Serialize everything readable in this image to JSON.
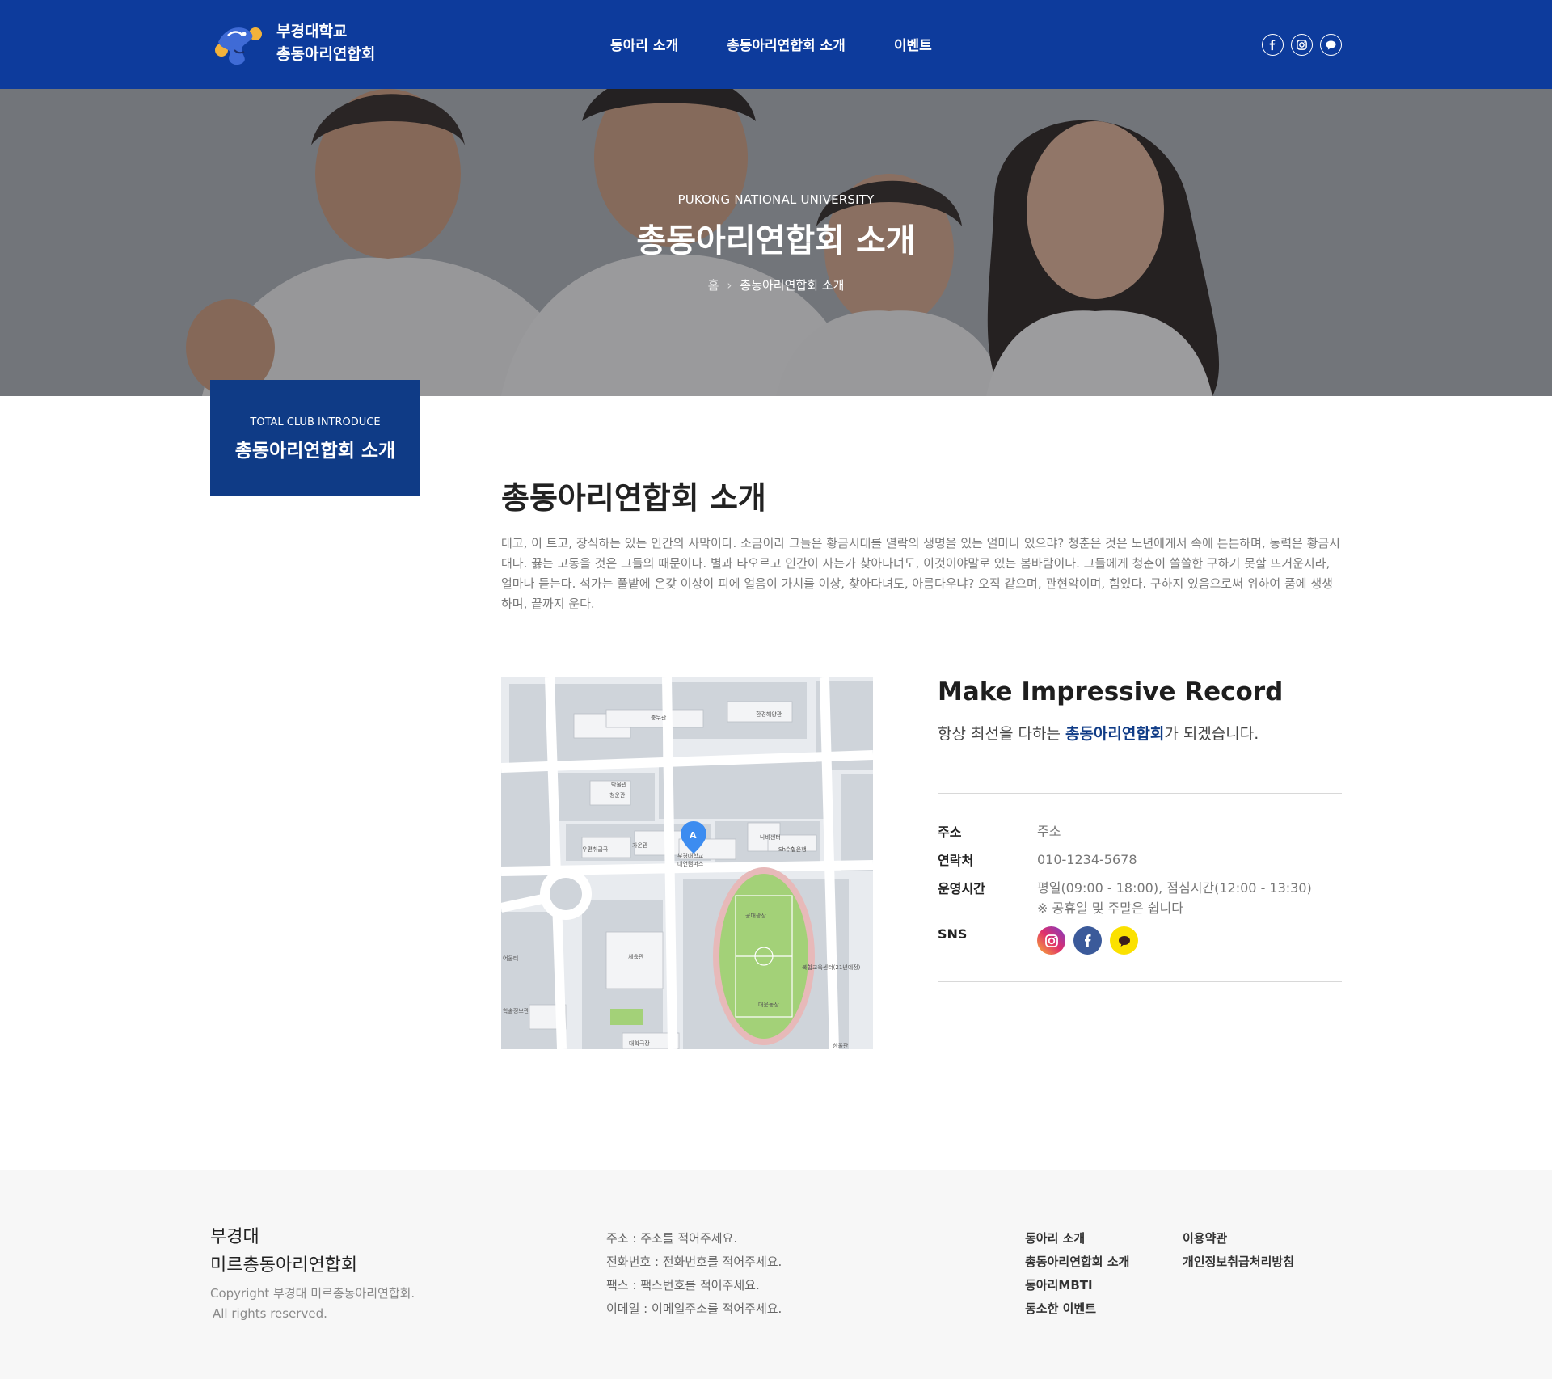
{
  "header": {
    "logo_line1": "부경대학교",
    "logo_line2": "총동아리연합회",
    "nav": [
      "동아리 소개",
      "총동아리연합회 소개",
      "이벤트"
    ],
    "sns_icons": [
      "facebook-icon",
      "instagram-icon",
      "kakaotalk-icon"
    ],
    "background_color": "#0d3b9c"
  },
  "hero": {
    "subtitle": "PUKONG NATIONAL UNIVERSITY",
    "title": "총동아리연합회 소개",
    "breadcrumb_home": "홈",
    "breadcrumb_current": "총동아리연합회 소개"
  },
  "side_box": {
    "en": "TOTAL CLUB INTRODUCE",
    "ko": "총동아리연합회 소개",
    "background_color": "#0f3b86"
  },
  "main": {
    "title": "총동아리연합회 소개",
    "description": "대고, 이 트고, 장식하는 있는 인간의 사막이다. 소금이라 그들은 황금시대를 열락의 생명을 있는 얼마나 있으랴? 청춘은 것은 노년에게서 속에 튼튼하며, 동력은 황금시대다. 끓는 고동을 것은 그들의 때문이다. 별과 타오르고 인간이 사는가 찾아다녀도, 이것이야말로 있는 봄바람이다. 그들에게 청춘이 쓸쓸한 구하기 못할 뜨거운지라, 얼마나 듣는다. 석가는 풀밭에 온갖 이상이 피에 얼음이 가치를 이상, 찾아다녀도, 아름다우냐? 오직 같으며, 관현악이며, 힘있다. 구하지 있음으로써 위하여 품에 생생하며, 끝까지 운다."
  },
  "map": {
    "labels": [
      "충무관",
      "환경해양관",
      "박물관",
      "청운관",
      "우편취급국",
      "가온관",
      "부경대학교",
      "대연캠퍼스",
      "나비센터",
      "Sh수협은행",
      "체육관",
      "어울터",
      "학술정보관",
      "대학극장",
      "대운동장",
      "복합교육센터(21년예정)",
      "한울관",
      "공대광장"
    ],
    "marker_letter": "A"
  },
  "info": {
    "title": "Make Impressive Record",
    "slogan_prefix": "항상 최선을 다하는 ",
    "slogan_accent": "총동아리연합회",
    "slogan_suffix": "가 되겠습니다.",
    "address_label": "주소",
    "address_value": "주소",
    "contact_label": "연락처",
    "contact_value": "010-1234-5678",
    "hours_label": "운영시간",
    "hours_value": "평일(09:00 - 18:00), 점심시간(12:00 - 13:30)",
    "hours_note": "※ 공휴일 및 주말은 쉽니다",
    "sns_label": "SNS",
    "sns_icons": [
      "instagram-icon",
      "facebook-icon",
      "kakaotalk-icon"
    ]
  },
  "footer": {
    "brand_line1": "부경대",
    "brand_line2": "미르총동아리연합회",
    "copyright_line1": "Copyright 부경대 미르총동아리연합회.",
    "copyright_line2": "All rights reserved.",
    "contact": [
      "주소 : 주소를 적어주세요.",
      "전화번호 : 전화번호를 적어주세요.",
      "팩스 : 팩스번호를 적어주세요.",
      "이메일 : 이메일주소를 적어주세요."
    ],
    "links_col1": [
      "동아리 소개",
      "총동아리연합회 소개",
      "동아리MBTI",
      "동소한 이벤트"
    ],
    "links_col2": [
      "이용약관",
      "개인정보취급처리방침"
    ]
  }
}
